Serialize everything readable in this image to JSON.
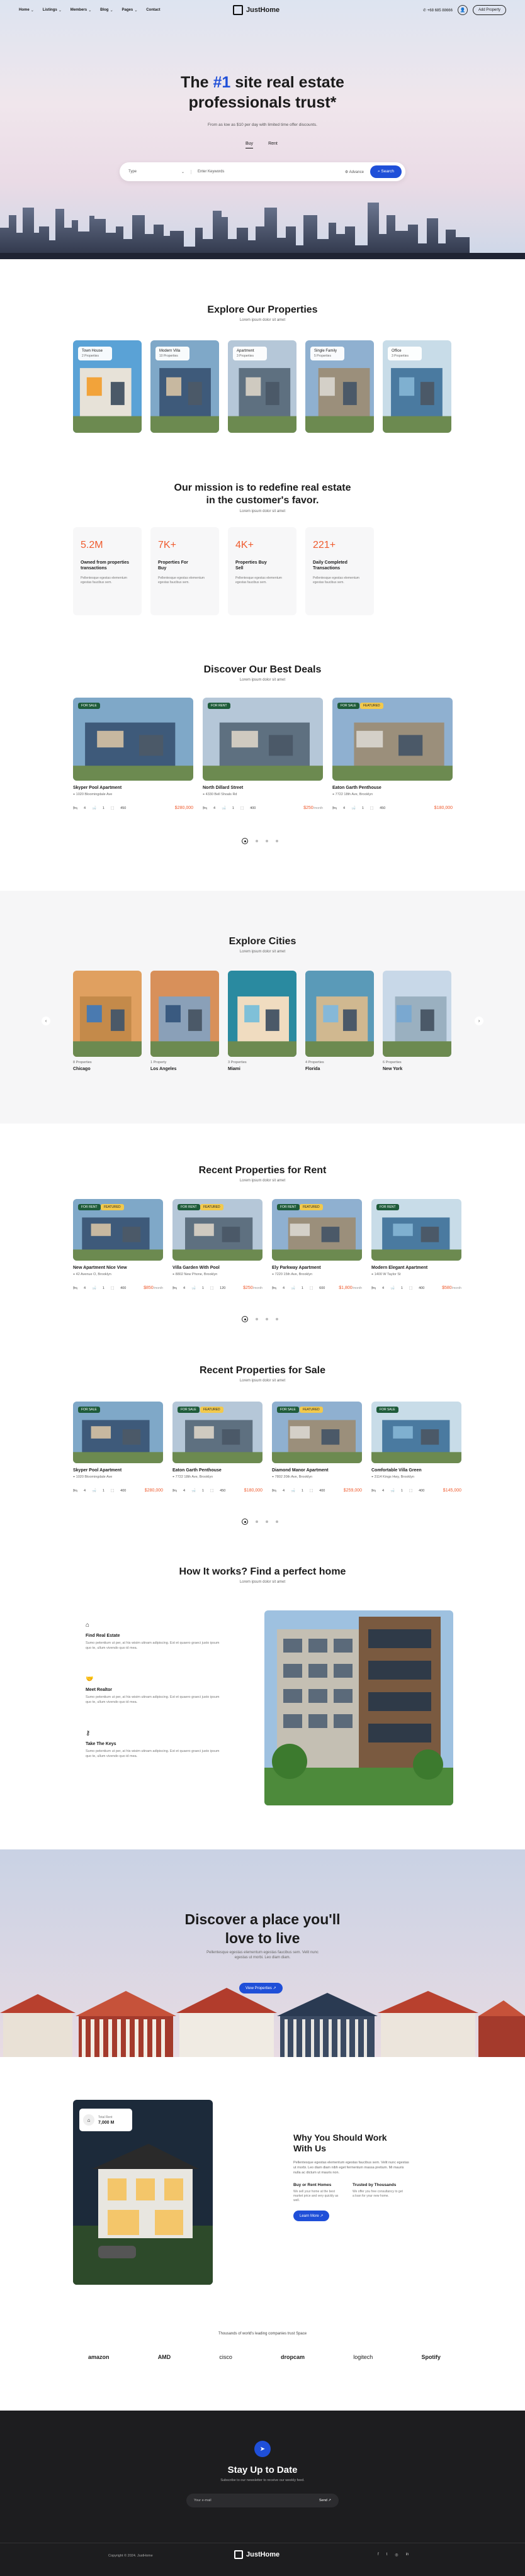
{
  "header": {
    "nav": [
      "Home",
      "Listings",
      "Members",
      "Blog",
      "Pages",
      "Contact"
    ],
    "logo": "JustHome",
    "phone": "+68 685 88666",
    "add_property": "Add Property"
  },
  "hero": {
    "title_a": "The ",
    "title_hl": "#1",
    "title_b": " site real estate",
    "title_c": "professionals trust*",
    "subtitle": "From as low as $10 per day with limited time offer discounts.",
    "tabs": [
      "Buy",
      "Rent"
    ],
    "search": {
      "type": "Type",
      "keyword": "Enter Keywords",
      "advance": "Advance",
      "button": "Search"
    }
  },
  "explore": {
    "title": "Explore Our Properties",
    "sub": "Lorem ipsum dolor sit amet",
    "items": [
      {
        "name": "Town House",
        "count": "2 Properties"
      },
      {
        "name": "Modern Villa",
        "count": "10 Properties"
      },
      {
        "name": "Apartment",
        "count": "3 Properties"
      },
      {
        "name": "Single Family",
        "count": "5 Properties"
      },
      {
        "name": "Office",
        "count": "3 Properties"
      }
    ]
  },
  "mission": {
    "title1": "Our mission is to redefine real estate",
    "title2": "in the customer's favor.",
    "sub": "Lorem ipsum dolor sit amet",
    "stats": [
      {
        "num": "5.2M",
        "t1": "Owned from properties",
        "t2": "transactions",
        "d": "Pellentesque egestas elementum egestas faucibus sem."
      },
      {
        "num": "7K+",
        "t1": "Properties For",
        "t2": "Buy",
        "d": "Pellentesque egestas elementum egestas faucibus sem."
      },
      {
        "num": "4K+",
        "t1": "Properties Buy",
        "t2": "Sell",
        "d": "Pellentesque egestas elementum egestas faucibus sem."
      },
      {
        "num": "221+",
        "t1": "Daily Completed",
        "t2": "Transactions",
        "d": "Pellentesque egestas elementum egestas faucibus sem."
      }
    ]
  },
  "deals": {
    "title": "Discover Our Best Deals",
    "sub": "Lorem ipsum dolor sit amet",
    "cards": [
      {
        "name": "Skyper Pool Apartment",
        "addr": "1020 Bloomingdale Ave",
        "beds": "4",
        "baths": "1",
        "sqft": "450",
        "price": "$280,000",
        "badge": "FOR SALE",
        "feat": ""
      },
      {
        "name": "North Dillard Street",
        "addr": "4330 Bell Shoals Rd",
        "beds": "4",
        "baths": "1",
        "sqft": "400",
        "price": "$250",
        "per": "/month",
        "badge": "FOR RENT",
        "feat": ""
      },
      {
        "name": "Eaton Garth Penthouse",
        "addr": "7722 18th Ave, Brooklyn",
        "beds": "4",
        "baths": "1",
        "sqft": "450",
        "price": "$180,000",
        "badge": "FOR SALE",
        "feat": "FEATURED"
      }
    ]
  },
  "cities": {
    "title": "Explore Cities",
    "sub": "Lorem ipsum dolor sit amet",
    "items": [
      {
        "count": "8 Properties",
        "name": "Chicago"
      },
      {
        "count": "1 Property",
        "name": "Los Angeles"
      },
      {
        "count": "3 Properties",
        "name": "Miami"
      },
      {
        "count": "4 Properties",
        "name": "Florida"
      },
      {
        "count": "6 Properties",
        "name": "New York"
      }
    ]
  },
  "rent": {
    "title": "Recent Properties for Rent",
    "sub": "Lorem ipsum dolor sit amet",
    "cards": [
      {
        "name": "New Apartment Nice View",
        "addr": "42 Avenue O, Brooklyn",
        "beds": "4",
        "baths": "1",
        "sqft": "400",
        "price": "$850",
        "per": "/month",
        "badge": "FOR RENT",
        "feat": "FEATURED"
      },
      {
        "name": "Villa Garden With Pool",
        "addr": "8802 New Phone, Brooklyn",
        "beds": "4",
        "baths": "1",
        "sqft": "120",
        "price": "$250",
        "per": "/month",
        "badge": "FOR RENT",
        "feat": "FEATURED"
      },
      {
        "name": "Ely Parkway Apartment",
        "addr": "7220 15th Ave, Brooklyn",
        "beds": "4",
        "baths": "1",
        "sqft": "600",
        "price": "$1,800",
        "per": "/month",
        "badge": "FOR RENT",
        "feat": "FEATURED"
      },
      {
        "name": "Modern Elegant Apartment",
        "addr": "1400 W Taylor St",
        "beds": "4",
        "baths": "1",
        "sqft": "400",
        "price": "$580",
        "per": "/month",
        "badge": "FOR RENT",
        "feat": ""
      }
    ]
  },
  "sale": {
    "title": "Recent Properties for Sale",
    "sub": "Lorem ipsum dolor sit amet",
    "cards": [
      {
        "name": "Skyper Pool Apartment",
        "addr": "1020 Bloomingdale Ave",
        "beds": "4",
        "baths": "1",
        "sqft": "400",
        "price": "$280,000",
        "badge": "FOR SALE",
        "feat": ""
      },
      {
        "name": "Eaton Garth Penthouse",
        "addr": "7722 18th Ave, Brooklyn",
        "beds": "4",
        "baths": "1",
        "sqft": "450",
        "price": "$180,000",
        "badge": "FOR SALE",
        "feat": "FEATURED"
      },
      {
        "name": "Diamond Manor Apartment",
        "addr": "7802 20th Ave, Brooklyn",
        "beds": "4",
        "baths": "1",
        "sqft": "400",
        "price": "$259,000",
        "badge": "FOR SALE",
        "feat": "FEATURED"
      },
      {
        "name": "Comfortable Villa Green",
        "addr": "3114 Kings Hwy, Brooklyn",
        "beds": "4",
        "baths": "1",
        "sqft": "400",
        "price": "$145,000",
        "badge": "FOR SALE",
        "feat": ""
      }
    ]
  },
  "how": {
    "title": "How It works? Find a perfect home",
    "sub": "Lorem ipsum dolor sit amet",
    "steps": [
      {
        "t": "Find Real Estate",
        "d": "Sumo petentium ut per, at his wisim utinam adipiscing. Est et quaero graeci justo ipsum quo te, ullum vivendo quo id mea."
      },
      {
        "t": "Meet Realtor",
        "d": "Sumo petentium ut per, at his wisim utinam adipiscing. Est et quaero graeci justo ipsum quo te, ullum vivendo quo id mea."
      },
      {
        "t": "Take The Keys",
        "d": "Sumo petentium ut per, at his wisim utinam adipiscing. Est et quaero graeci justo ipsum quo te, ullum vivendo quo id mea."
      }
    ]
  },
  "discover": {
    "title1": "Discover a place you'll",
    "title2": "love to live",
    "sub1": "Pellentesque egestas elementum egestas faucibus sem. Velit nunc",
    "sub2": "egestas ut morbi. Leo diam diam.",
    "button": "View Properties"
  },
  "why": {
    "total_label": "Total Rent",
    "total_value": "7,000 M",
    "title1": "Why You Should Work",
    "title2": "With Us",
    "desc": "Pellentesque egestas elementum egestas faucibus sem. Velit nunc egestas ut morbi. Leo diam diam nibh eget fermentum massa pretium. Mi mauris nulla ac dictum ut mauris non.",
    "f1t": "Buy or Rent Homes",
    "f1d": "We sell your home at the best market price and very quickly as well.",
    "f2t": "Trusted by Thousands",
    "f2d": "We offer you free consultancy to get a loan for your new home.",
    "button": "Learn More"
  },
  "brands": {
    "caption": "Thousands of world's leading companies trust Space",
    "items": [
      "amazon",
      "AMD",
      "cisco",
      "dropcam",
      "logitech",
      "Spotify"
    ]
  },
  "footer": {
    "title": "Stay Up to Date",
    "sub": "Subscribe to our newsletter to receive our weekly feed.",
    "email": "Your e-mail",
    "send": "Send",
    "copyright": "Copyright © 2024. JustHome",
    "logo": "JustHome"
  }
}
